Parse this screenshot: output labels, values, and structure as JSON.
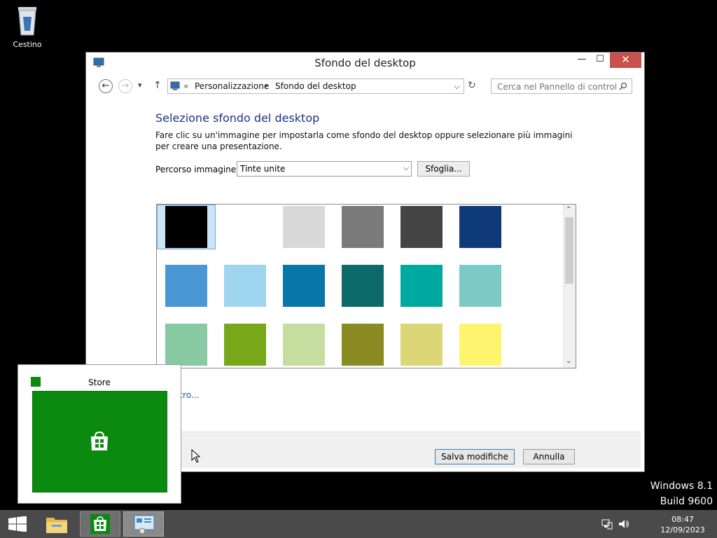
{
  "desktop": {
    "icons": [
      {
        "label": "Cestino",
        "icon": "recycle-bin-icon"
      }
    ],
    "watermark": {
      "line1": "Windows 8.1",
      "line2": "Build 9600"
    }
  },
  "window": {
    "title": "Sfondo del desktop",
    "close_label": "✕",
    "maximize_label": "☐",
    "minimize_label": "—",
    "nav": {
      "back": "←",
      "forward": "→",
      "recent": "▾",
      "up": "↑",
      "overflow": "«",
      "breadcrumb": [
        "Personalizzazione",
        "Sfondo del desktop"
      ],
      "separator": "▸",
      "dropdown": "⌵",
      "refresh": "↻",
      "search_placeholder": "Cerca nel Pannello di controllo",
      "search_icon": "search-icon"
    },
    "heading": "Selezione sfondo del desktop",
    "description": "Fare clic su un'immagine per impostarla come sfondo del desktop oppure selezionare più immagini per creare una presentazione.",
    "path_label": "Percorso immagine:",
    "path_value": "Tinte unite",
    "path_arrow": "⌵",
    "browse_label": "Sfoglia...",
    "scroll_up": "⌃",
    "scroll_down": "⌄",
    "swatches": [
      [
        "#000000",
        "#ffffff",
        "#d8d8d8",
        "#7a7a7a",
        "#444444",
        "#0f3a7a"
      ],
      [
        "#4a97d6",
        "#9fd5ee",
        "#0777a8",
        "#0d6a6a",
        "#00a9a0",
        "#7ccac6"
      ],
      [
        "#87c9a2",
        "#78a81a",
        "#c5dd9f",
        "#8a8b22",
        "#dbd676",
        "#fff46d"
      ]
    ],
    "more_link": "ltro...",
    "save_label": "Salva modifiche",
    "cancel_label": "Annulla"
  },
  "store_preview": {
    "title": "Store"
  },
  "taskbar": {
    "time": "08:47",
    "date": "12/09/2023",
    "tray_icons": [
      "network-icon",
      "volume-icon"
    ]
  }
}
